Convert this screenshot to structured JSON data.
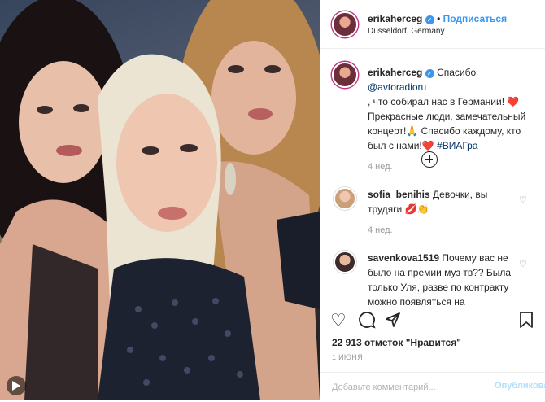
{
  "post": {
    "author": "erikaherceg",
    "follow_label": "Подписаться",
    "location": "Düsseldorf, Germany"
  },
  "caption": {
    "author": "erikaherceg",
    "text_1": "Спасибо ",
    "mention": "@avtoradioru",
    "text_2": ", что собирал нас в Германии! ❤️",
    "text_3": "Прекрасные люди, замечательный",
    "text_4": "концерт!🙏 Спасибо каждому, кто",
    "text_5": "был с нами!❤️ ",
    "hashtag": "#ВИАГра",
    "time": "4 нед."
  },
  "comments": [
    {
      "author": "sofia_benihis",
      "text_1": " Девочки, вы",
      "text_2": "трудяги 💋👏",
      "time": "4 нед."
    },
    {
      "author": "savenkova1519",
      "text_1": " Почему вас не",
      "text_2": "было на премии муз тв?? Была",
      "text_3": "только Уля, разве по контракту",
      "text_4": "можно появляться на"
    }
  ],
  "actions": {
    "likes": "22 913 отметок \"Нравится\"",
    "date": "1 ИЮНЯ",
    "comment_placeholder": "Добавьте комментарий...",
    "publish_label": "Опубликовать"
  },
  "icons": {
    "like": "heart-icon",
    "comment": "comment-icon",
    "share": "share-icon",
    "save": "bookmark-icon",
    "more_comments": "plus-circle-icon",
    "photo_more": "play-icon",
    "verified": "verified-badge-icon"
  },
  "colors": {
    "accent": "#3897f0",
    "link": "#003569",
    "muted": "#999999"
  }
}
